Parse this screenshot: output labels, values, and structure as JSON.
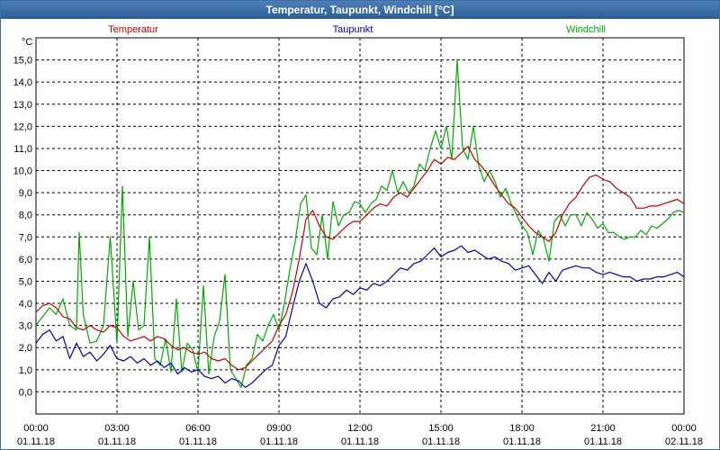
{
  "title": "Temperatur, Taupunkt, Windchill [°C]",
  "chart_data": {
    "type": "line",
    "ylabel": "°C",
    "ylim": [
      -1.0,
      16.0
    ],
    "yticks": [
      "0,0",
      "1,0",
      "2,0",
      "3,0",
      "4,0",
      "5,0",
      "6,0",
      "7,0",
      "8,0",
      "9,0",
      "10,0",
      "11,0",
      "12,0",
      "13,0",
      "14,0",
      "15,0"
    ],
    "x_hours_range": [
      0,
      24
    ],
    "xticks": [
      {
        "time": "00:00",
        "date": "01.11.18"
      },
      {
        "time": "03:00",
        "date": "01.11.18"
      },
      {
        "time": "06:00",
        "date": "01.11.18"
      },
      {
        "time": "09:00",
        "date": "01.11.18"
      },
      {
        "time": "12:00",
        "date": "01.11.18"
      },
      {
        "time": "15:00",
        "date": "01.11.18"
      },
      {
        "time": "18:00",
        "date": "01.11.18"
      },
      {
        "time": "21:00",
        "date": "01.11.18"
      },
      {
        "time": "00:00",
        "date": "02.11.18"
      }
    ],
    "grid": true,
    "series": [
      {
        "name": "Temperatur",
        "color": "#c00000",
        "points": [
          [
            0.0,
            3.6
          ],
          [
            0.25,
            3.9
          ],
          [
            0.5,
            4.0
          ],
          [
            0.75,
            3.8
          ],
          [
            1.0,
            3.4
          ],
          [
            1.25,
            3.3
          ],
          [
            1.5,
            2.9
          ],
          [
            1.75,
            2.8
          ],
          [
            2.0,
            3.0
          ],
          [
            2.25,
            2.8
          ],
          [
            2.5,
            2.7
          ],
          [
            2.75,
            3.0
          ],
          [
            3.0,
            2.9
          ],
          [
            3.25,
            2.5
          ],
          [
            3.5,
            2.3
          ],
          [
            3.75,
            2.4
          ],
          [
            4.0,
            2.5
          ],
          [
            4.25,
            2.3
          ],
          [
            4.5,
            2.5
          ],
          [
            4.75,
            2.4
          ],
          [
            5.0,
            2.1
          ],
          [
            5.25,
            1.9
          ],
          [
            5.5,
            2.0
          ],
          [
            5.75,
            1.8
          ],
          [
            6.0,
            1.7
          ],
          [
            6.25,
            1.8
          ],
          [
            6.5,
            1.5
          ],
          [
            6.75,
            1.4
          ],
          [
            7.0,
            1.5
          ],
          [
            7.25,
            1.2
          ],
          [
            7.5,
            1.0
          ],
          [
            7.75,
            1.1
          ],
          [
            8.0,
            1.4
          ],
          [
            8.25,
            1.7
          ],
          [
            8.5,
            2.0
          ],
          [
            8.75,
            2.3
          ],
          [
            9.0,
            3.0
          ],
          [
            9.25,
            3.5
          ],
          [
            9.5,
            4.5
          ],
          [
            9.75,
            6.0
          ],
          [
            10.0,
            7.8
          ],
          [
            10.25,
            8.2
          ],
          [
            10.5,
            7.5
          ],
          [
            10.75,
            7.0
          ],
          [
            11.0,
            6.9
          ],
          [
            11.25,
            7.2
          ],
          [
            11.5,
            7.5
          ],
          [
            11.75,
            7.7
          ],
          [
            12.0,
            7.7
          ],
          [
            12.25,
            8.0
          ],
          [
            12.5,
            8.3
          ],
          [
            12.75,
            8.5
          ],
          [
            13.0,
            8.4
          ],
          [
            13.25,
            8.8
          ],
          [
            13.5,
            9.0
          ],
          [
            13.75,
            8.8
          ],
          [
            14.0,
            9.2
          ],
          [
            14.25,
            9.6
          ],
          [
            14.5,
            10.0
          ],
          [
            14.75,
            10.5
          ],
          [
            15.0,
            10.3
          ],
          [
            15.25,
            10.6
          ],
          [
            15.5,
            10.5
          ],
          [
            15.75,
            10.8
          ],
          [
            16.0,
            11.1
          ],
          [
            16.25,
            10.5
          ],
          [
            16.5,
            10.2
          ],
          [
            16.75,
            9.8
          ],
          [
            17.0,
            9.3
          ],
          [
            17.25,
            8.9
          ],
          [
            17.5,
            8.5
          ],
          [
            17.75,
            8.3
          ],
          [
            18.0,
            7.9
          ],
          [
            18.25,
            7.5
          ],
          [
            18.5,
            7.2
          ],
          [
            18.75,
            7.0
          ],
          [
            19.0,
            6.8
          ],
          [
            19.25,
            7.2
          ],
          [
            19.5,
            8.0
          ],
          [
            19.75,
            8.5
          ],
          [
            20.0,
            8.8
          ],
          [
            20.25,
            9.3
          ],
          [
            20.5,
            9.7
          ],
          [
            20.75,
            9.8
          ],
          [
            21.0,
            9.6
          ],
          [
            21.25,
            9.5
          ],
          [
            21.5,
            9.2
          ],
          [
            21.75,
            9.0
          ],
          [
            22.0,
            8.8
          ],
          [
            22.25,
            8.3
          ],
          [
            22.5,
            8.3
          ],
          [
            22.75,
            8.4
          ],
          [
            23.0,
            8.4
          ],
          [
            23.25,
            8.5
          ],
          [
            23.5,
            8.6
          ],
          [
            23.75,
            8.7
          ],
          [
            24.0,
            8.5
          ]
        ]
      },
      {
        "name": "Taupunkt",
        "color": "#0000b0",
        "points": [
          [
            0.0,
            2.2
          ],
          [
            0.25,
            2.6
          ],
          [
            0.5,
            2.8
          ],
          [
            0.75,
            2.3
          ],
          [
            1.0,
            2.5
          ],
          [
            1.25,
            1.5
          ],
          [
            1.5,
            2.2
          ],
          [
            1.75,
            1.6
          ],
          [
            2.0,
            1.8
          ],
          [
            2.25,
            1.4
          ],
          [
            2.5,
            1.7
          ],
          [
            2.75,
            2.1
          ],
          [
            3.0,
            1.5
          ],
          [
            3.25,
            1.4
          ],
          [
            3.5,
            1.6
          ],
          [
            3.75,
            1.3
          ],
          [
            4.0,
            1.5
          ],
          [
            4.25,
            1.2
          ],
          [
            4.5,
            1.4
          ],
          [
            4.75,
            1.1
          ],
          [
            5.0,
            1.3
          ],
          [
            5.25,
            0.8
          ],
          [
            5.5,
            1.1
          ],
          [
            5.75,
            0.9
          ],
          [
            6.0,
            1.0
          ],
          [
            6.25,
            0.7
          ],
          [
            6.5,
            0.6
          ],
          [
            6.75,
            0.7
          ],
          [
            7.0,
            0.4
          ],
          [
            7.25,
            0.6
          ],
          [
            7.5,
            0.5
          ],
          [
            7.75,
            0.2
          ],
          [
            8.0,
            0.4
          ],
          [
            8.25,
            0.7
          ],
          [
            8.5,
            1.0
          ],
          [
            8.75,
            1.2
          ],
          [
            9.0,
            2.1
          ],
          [
            9.25,
            2.5
          ],
          [
            9.5,
            3.8
          ],
          [
            9.75,
            5.0
          ],
          [
            10.0,
            5.8
          ],
          [
            10.25,
            5.0
          ],
          [
            10.5,
            4.0
          ],
          [
            10.75,
            3.8
          ],
          [
            11.0,
            4.2
          ],
          [
            11.25,
            4.3
          ],
          [
            11.5,
            4.6
          ],
          [
            11.75,
            4.4
          ],
          [
            12.0,
            4.7
          ],
          [
            12.25,
            4.6
          ],
          [
            12.5,
            4.9
          ],
          [
            12.75,
            4.8
          ],
          [
            13.0,
            5.0
          ],
          [
            13.25,
            5.3
          ],
          [
            13.5,
            5.6
          ],
          [
            13.75,
            5.5
          ],
          [
            14.0,
            5.8
          ],
          [
            14.25,
            5.9
          ],
          [
            14.5,
            6.2
          ],
          [
            14.75,
            6.5
          ],
          [
            15.0,
            6.1
          ],
          [
            15.25,
            6.3
          ],
          [
            15.5,
            6.4
          ],
          [
            15.75,
            6.6
          ],
          [
            16.0,
            6.3
          ],
          [
            16.25,
            6.4
          ],
          [
            16.5,
            6.2
          ],
          [
            16.75,
            6.0
          ],
          [
            17.0,
            6.1
          ],
          [
            17.25,
            5.9
          ],
          [
            17.5,
            5.8
          ],
          [
            17.75,
            5.5
          ],
          [
            18.0,
            5.6
          ],
          [
            18.25,
            5.7
          ],
          [
            18.5,
            5.3
          ],
          [
            18.75,
            4.9
          ],
          [
            19.0,
            5.4
          ],
          [
            19.25,
            5.0
          ],
          [
            19.5,
            5.5
          ],
          [
            19.75,
            5.6
          ],
          [
            20.0,
            5.7
          ],
          [
            20.25,
            5.6
          ],
          [
            20.5,
            5.6
          ],
          [
            20.75,
            5.4
          ],
          [
            21.0,
            5.3
          ],
          [
            21.25,
            5.4
          ],
          [
            21.5,
            5.3
          ],
          [
            21.75,
            5.2
          ],
          [
            22.0,
            5.2
          ],
          [
            22.25,
            5.0
          ],
          [
            22.5,
            5.1
          ],
          [
            22.75,
            5.1
          ],
          [
            23.0,
            5.2
          ],
          [
            23.25,
            5.2
          ],
          [
            23.5,
            5.3
          ],
          [
            23.75,
            5.4
          ],
          [
            24.0,
            5.2
          ]
        ]
      },
      {
        "name": "Windchill",
        "color": "#00aa00",
        "points": [
          [
            0.0,
            3.0
          ],
          [
            0.25,
            3.4
          ],
          [
            0.5,
            3.8
          ],
          [
            0.75,
            3.5
          ],
          [
            1.0,
            4.2
          ],
          [
            1.25,
            3.0
          ],
          [
            1.5,
            2.8
          ],
          [
            1.6,
            7.2
          ],
          [
            1.75,
            3.5
          ],
          [
            2.0,
            2.2
          ],
          [
            2.25,
            2.3
          ],
          [
            2.5,
            3.0
          ],
          [
            2.75,
            7.0
          ],
          [
            3.0,
            2.2
          ],
          [
            3.2,
            9.3
          ],
          [
            3.4,
            2.5
          ],
          [
            3.6,
            5.0
          ],
          [
            3.8,
            2.8
          ],
          [
            4.0,
            3.0
          ],
          [
            4.2,
            7.0
          ],
          [
            4.4,
            1.5
          ],
          [
            4.6,
            1.2
          ],
          [
            4.8,
            2.4
          ],
          [
            5.0,
            0.9
          ],
          [
            5.2,
            4.2
          ],
          [
            5.4,
            0.9
          ],
          [
            5.6,
            2.2
          ],
          [
            5.8,
            1.9
          ],
          [
            6.0,
            0.9
          ],
          [
            6.2,
            4.8
          ],
          [
            6.4,
            0.8
          ],
          [
            6.6,
            2.5
          ],
          [
            6.8,
            3.2
          ],
          [
            7.0,
            5.3
          ],
          [
            7.2,
            1.0
          ],
          [
            7.4,
            0.6
          ],
          [
            7.6,
            0.2
          ],
          [
            7.8,
            1.2
          ],
          [
            8.0,
            1.5
          ],
          [
            8.2,
            2.6
          ],
          [
            8.4,
            2.3
          ],
          [
            8.6,
            3.0
          ],
          [
            8.8,
            3.5
          ],
          [
            9.0,
            2.8
          ],
          [
            9.2,
            4.0
          ],
          [
            9.4,
            5.5
          ],
          [
            9.6,
            6.8
          ],
          [
            9.8,
            8.5
          ],
          [
            10.0,
            8.9
          ],
          [
            10.2,
            6.5
          ],
          [
            10.4,
            6.2
          ],
          [
            10.6,
            8.0
          ],
          [
            10.8,
            6.0
          ],
          [
            11.0,
            8.6
          ],
          [
            11.2,
            7.5
          ],
          [
            11.4,
            8.0
          ],
          [
            11.6,
            8.1
          ],
          [
            11.8,
            8.6
          ],
          [
            12.0,
            8.5
          ],
          [
            12.2,
            8.1
          ],
          [
            12.4,
            8.5
          ],
          [
            12.6,
            8.7
          ],
          [
            12.8,
            9.3
          ],
          [
            13.0,
            9.1
          ],
          [
            13.2,
            10.0
          ],
          [
            13.4,
            9.0
          ],
          [
            13.6,
            9.5
          ],
          [
            13.8,
            9.0
          ],
          [
            14.0,
            9.3
          ],
          [
            14.2,
            10.3
          ],
          [
            14.4,
            10.0
          ],
          [
            14.6,
            11.0
          ],
          [
            14.8,
            11.8
          ],
          [
            15.0,
            11.0
          ],
          [
            15.2,
            12.0
          ],
          [
            15.4,
            10.5
          ],
          [
            15.6,
            15.0
          ],
          [
            15.8,
            11.0
          ],
          [
            16.0,
            10.5
          ],
          [
            16.2,
            12.0
          ],
          [
            16.4,
            10.2
          ],
          [
            16.6,
            9.5
          ],
          [
            16.8,
            10.0
          ],
          [
            17.0,
            9.5
          ],
          [
            17.2,
            8.8
          ],
          [
            17.4,
            9.2
          ],
          [
            17.6,
            8.5
          ],
          [
            17.8,
            8.0
          ],
          [
            18.0,
            7.5
          ],
          [
            18.2,
            7.2
          ],
          [
            18.4,
            6.2
          ],
          [
            18.6,
            7.3
          ],
          [
            18.8,
            6.9
          ],
          [
            19.0,
            5.9
          ],
          [
            19.2,
            7.7
          ],
          [
            19.4,
            8.0
          ],
          [
            19.6,
            7.5
          ],
          [
            19.8,
            8.0
          ],
          [
            20.0,
            8.0
          ],
          [
            20.2,
            7.5
          ],
          [
            20.4,
            8.1
          ],
          [
            20.6,
            7.8
          ],
          [
            20.8,
            7.4
          ],
          [
            21.0,
            7.6
          ],
          [
            21.2,
            7.2
          ],
          [
            21.4,
            7.2
          ],
          [
            21.6,
            7.0
          ],
          [
            21.8,
            6.9
          ],
          [
            22.0,
            7.0
          ],
          [
            22.2,
            7.0
          ],
          [
            22.4,
            7.3
          ],
          [
            22.6,
            7.1
          ],
          [
            22.8,
            7.5
          ],
          [
            23.0,
            7.4
          ],
          [
            23.2,
            7.6
          ],
          [
            23.4,
            7.8
          ],
          [
            23.6,
            8.1
          ],
          [
            23.8,
            8.2
          ],
          [
            24.0,
            8.1
          ]
        ]
      }
    ]
  }
}
